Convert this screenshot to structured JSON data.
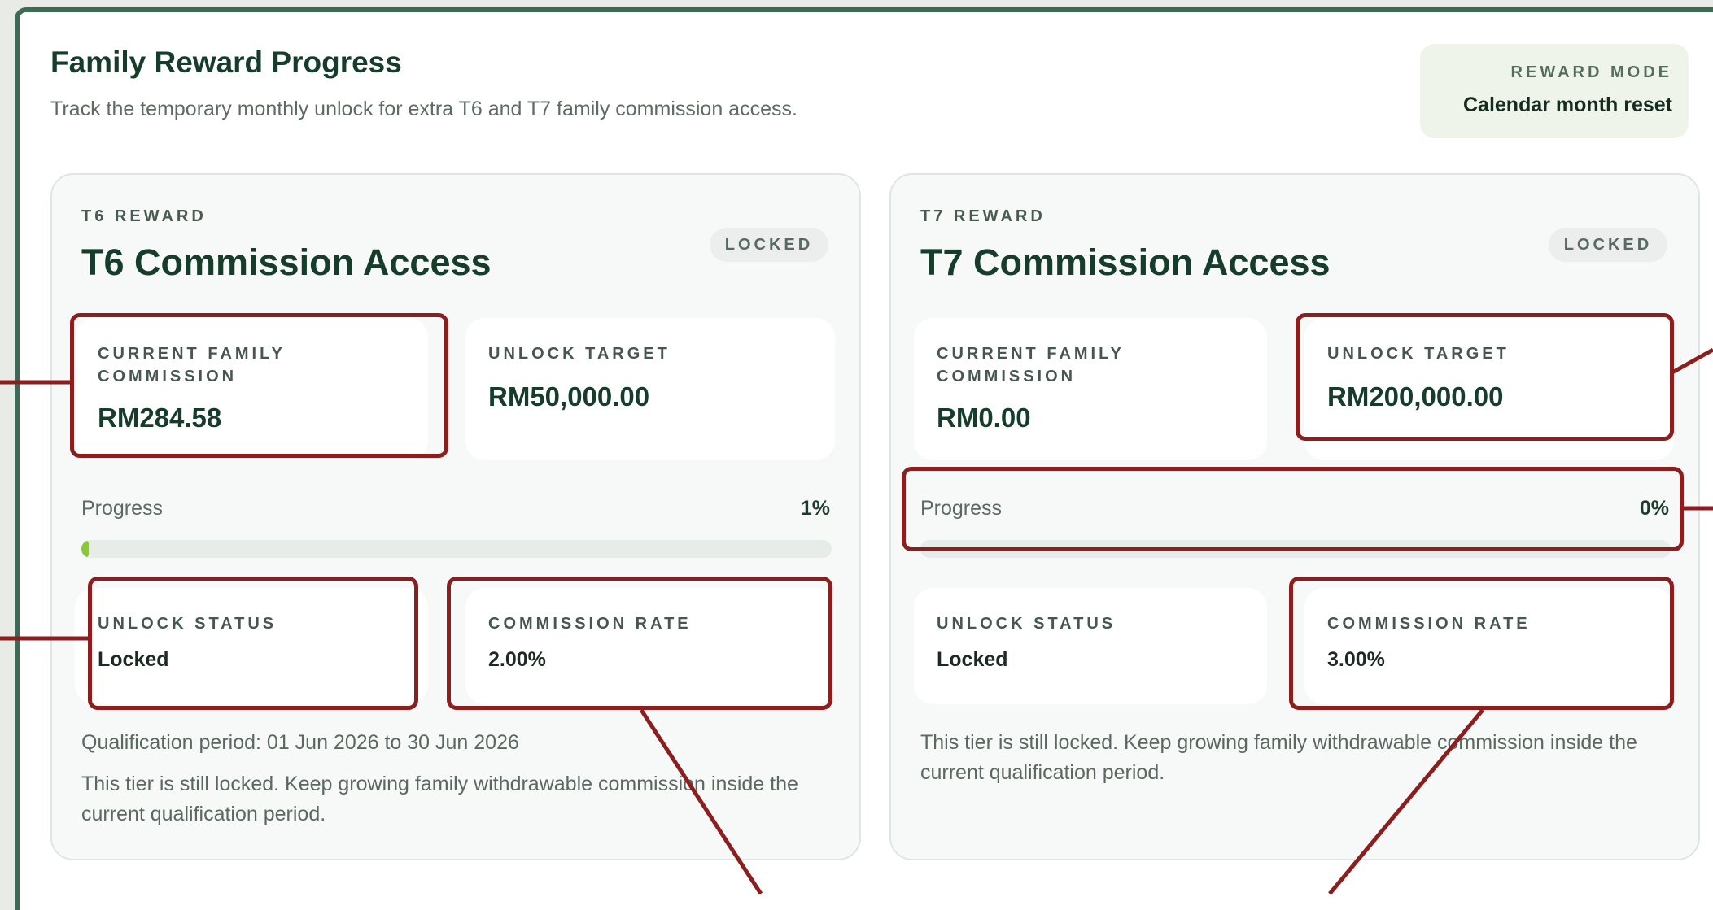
{
  "header": {
    "title": "Family Reward Progress",
    "subtitle": "Track the temporary monthly unlock for extra T6 and T7 family commission access."
  },
  "reward_mode": {
    "label": "REWARD MODE",
    "value": "Calendar month reset"
  },
  "cards": [
    {
      "eyebrow": "T6 REWARD",
      "title": "T6 Commission Access",
      "badge": "LOCKED",
      "current_family_commission": {
        "label": "CURRENT FAMILY COMMISSION",
        "value": "RM284.58"
      },
      "unlock_target": {
        "label": "UNLOCK TARGET",
        "value": "RM50,000.00"
      },
      "progress": {
        "label": "Progress",
        "percent_text": "1%",
        "fraction": 0.01
      },
      "unlock_status": {
        "label": "UNLOCK STATUS",
        "value": "Locked"
      },
      "commission_rate": {
        "label": "COMMISSION RATE",
        "value": "2.00%"
      },
      "qualification_period": "Qualification period: 01 Jun 2026 to 30 Jun 2026",
      "message": "This tier is still locked. Keep growing family withdrawable commission inside the current qualification period."
    },
    {
      "eyebrow": "T7 REWARD",
      "title": "T7 Commission Access",
      "badge": "LOCKED",
      "current_family_commission": {
        "label": "CURRENT FAMILY COMMISSION",
        "value": "RM0.00"
      },
      "unlock_target": {
        "label": "UNLOCK TARGET",
        "value": "RM200,000.00"
      },
      "progress": {
        "label": "Progress",
        "percent_text": "0%",
        "fraction": 0.0
      },
      "unlock_status": {
        "label": "UNLOCK STATUS",
        "value": "Locked"
      },
      "commission_rate": {
        "label": "COMMISSION RATE",
        "value": "3.00%"
      },
      "message": "This tier is still locked. Keep growing family withdrawable commission inside the current qualification period."
    }
  ],
  "colors": {
    "frame_border": "#3e6a55",
    "title_green": "#163d2b",
    "progress_fill": "#8cc63e",
    "annotation_red": "#8b1e1e"
  }
}
